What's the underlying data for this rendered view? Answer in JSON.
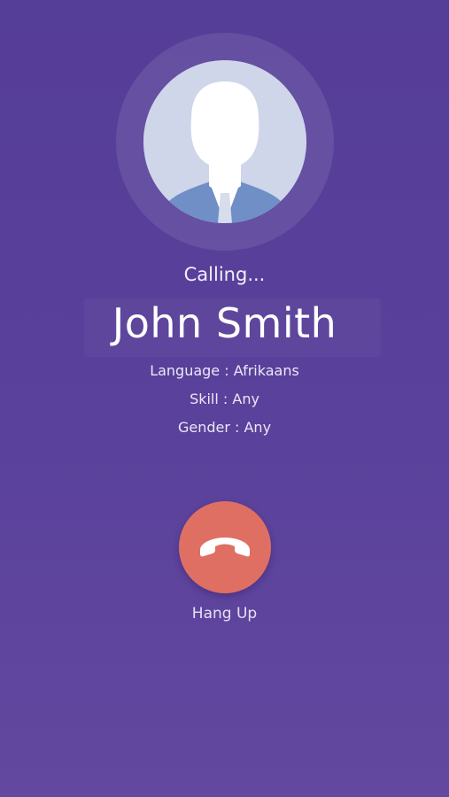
{
  "call": {
    "status": "Calling...",
    "contact_name": "John Smith"
  },
  "details": {
    "language": "Language : Afrikaans",
    "skill": "Skill : Any",
    "gender": "Gender : Any"
  },
  "actions": {
    "hangup_label": "Hang Up",
    "hangup_icon": "phone-hangup-icon",
    "avatar_icon": "default-person-avatar-icon"
  },
  "colors": {
    "background": "#563f99",
    "hangup_button": "#e06f63",
    "avatar_background": "#cfd6ea",
    "avatar_suit": "#6f8fc6"
  }
}
